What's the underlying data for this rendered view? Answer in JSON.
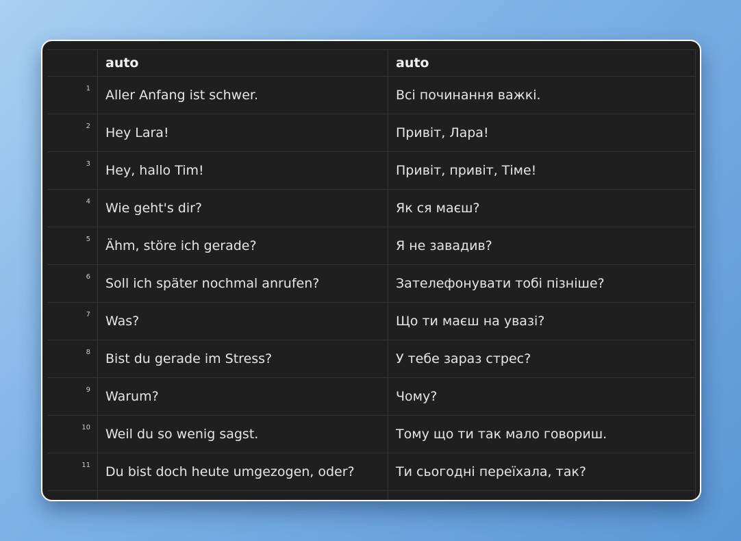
{
  "table": {
    "headers": {
      "source": "auto",
      "target": "auto"
    },
    "rows": [
      {
        "n": "1",
        "source": "Aller Anfang ist schwer.",
        "target": "Всі починання важкі."
      },
      {
        "n": "2",
        "source": "Hey Lara!",
        "target": "Привіт, Лара!"
      },
      {
        "n": "3",
        "source": "Hey, hallo Tim!",
        "target": "Привіт, привіт, Тіме!"
      },
      {
        "n": "4",
        "source": "Wie geht's dir?",
        "target": "Як ся маєш?"
      },
      {
        "n": "5",
        "source": "Ähm, störe ich gerade?",
        "target": "Я не завадив?"
      },
      {
        "n": "6",
        "source": "Soll ich später nochmal anrufen?",
        "target": "Зателефонувати тобі пізніше?"
      },
      {
        "n": "7",
        "source": "Was?",
        "target": "Що ти маєш на увазі?"
      },
      {
        "n": "8",
        "source": "Bist du gerade im Stress?",
        "target": "У тебе зараз стрес?"
      },
      {
        "n": "9",
        "source": "Warum?",
        "target": "Чому?"
      },
      {
        "n": "10",
        "source": "Weil du so wenig sagst.",
        "target": "Тому що ти так мало говориш."
      },
      {
        "n": "11",
        "source": "Du bist doch heute umgezogen, oder?",
        "target": "Ти сьогодні переїхала, так?"
      }
    ]
  }
}
